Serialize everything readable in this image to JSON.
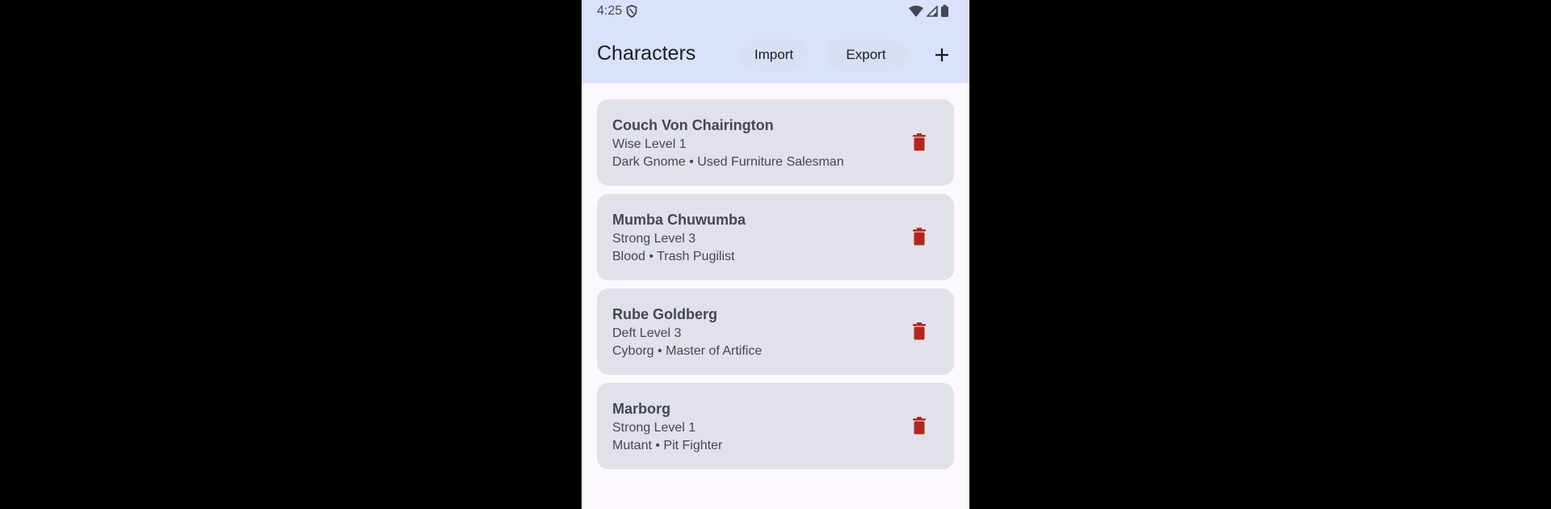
{
  "status_bar": {
    "time": "4:25",
    "icons": [
      "shield-icon",
      "wifi-icon",
      "signal-icon",
      "battery-icon"
    ]
  },
  "app_bar": {
    "title": "Characters",
    "import_label": "Import",
    "export_label": "Export",
    "add_icon": "plus-icon"
  },
  "colors": {
    "header_bg": "#dae1fb",
    "card_bg": "#e1e2e9",
    "delete_icon": "#b3261e",
    "page_bg": "#fcf8fd"
  },
  "characters": [
    {
      "name": "Couch Von Chairington",
      "level": "Wise Level 1",
      "description": "Dark Gnome • Used Furniture Salesman"
    },
    {
      "name": "Mumba Chuwumba",
      "level": "Strong Level 3",
      "description": "Blood • Trash Pugilist"
    },
    {
      "name": "Rube Goldberg",
      "level": "Deft Level 3",
      "description": "Cyborg • Master of Artifice"
    },
    {
      "name": "Marborg",
      "level": "Strong Level 1",
      "description": "Mutant • Pit Fighter"
    }
  ]
}
